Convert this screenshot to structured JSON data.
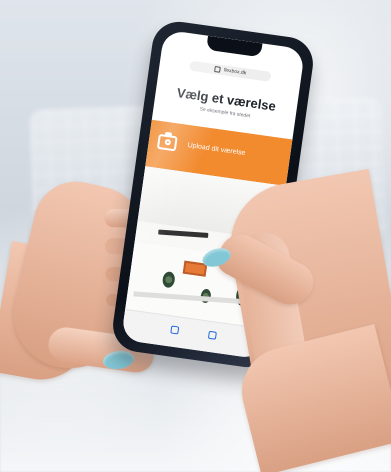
{
  "scene": {
    "type": "photo-of-smartphone-being-held",
    "background_colors": [
      "#dfe5eb",
      "#cfd6de",
      "#dce2e8"
    ],
    "accent_color": "#f28a2e",
    "nail_color": "#82c7d5"
  },
  "phone": {
    "address": "flexbox.dk",
    "title": "Vælg et værelse",
    "subtitle": "Se eksemple fra stedet",
    "upload_label": "Upload dit værelse",
    "icons": {
      "lock": "lock-icon",
      "camera": "camera-icon",
      "bottom_left": "square-icon",
      "bottom_right": "square-icon"
    }
  }
}
